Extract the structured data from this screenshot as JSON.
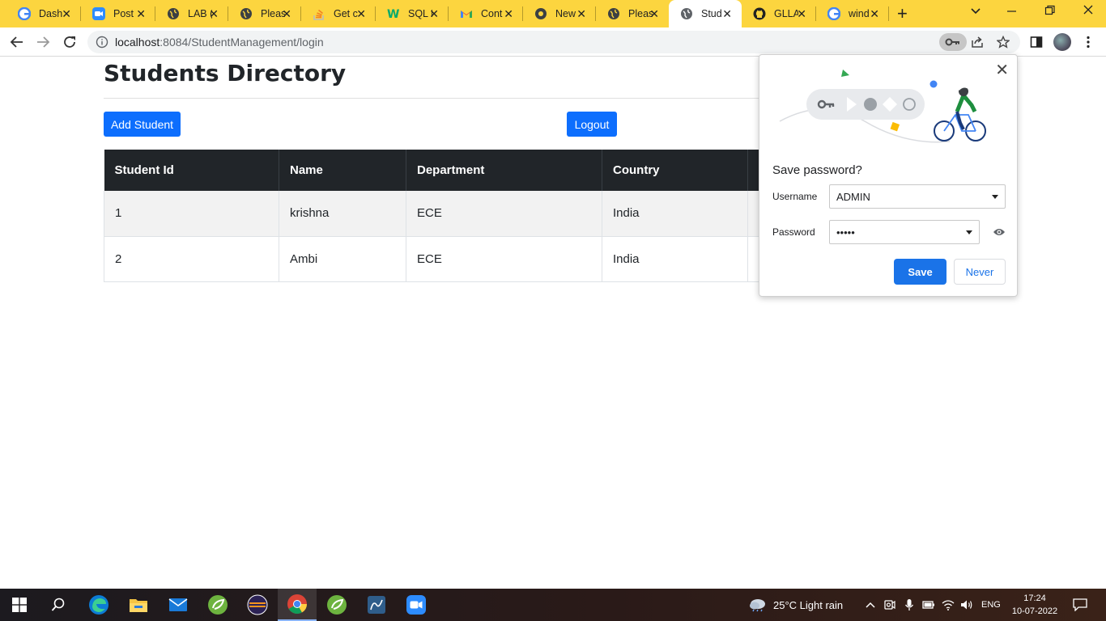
{
  "browser": {
    "tabs": [
      {
        "title": "Dash",
        "icon": "google-g-icon",
        "active": false
      },
      {
        "title": "Post",
        "icon": "zoom-icon",
        "active": false
      },
      {
        "title": "LAB (",
        "icon": "globe-icon",
        "active": false
      },
      {
        "title": "Pleas",
        "icon": "globe-icon",
        "active": false
      },
      {
        "title": "Get c",
        "icon": "stackoverflow-icon",
        "active": false
      },
      {
        "title": "SQL I",
        "icon": "w3schools-icon",
        "active": false
      },
      {
        "title": "Cont",
        "icon": "gmail-icon",
        "active": false
      },
      {
        "title": "New",
        "icon": "chrome-icon",
        "active": false
      },
      {
        "title": "Pleas",
        "icon": "globe-icon",
        "active": false
      },
      {
        "title": "Stud",
        "icon": "globe-icon",
        "active": true
      },
      {
        "title": "GLLA",
        "icon": "github-icon",
        "active": false
      },
      {
        "title": "wind",
        "icon": "google-g-icon",
        "active": false
      }
    ],
    "url_host": "localhost",
    "url_rest": ":8084/StudentManagement/login"
  },
  "page": {
    "title": "Students Directory",
    "add_button": "Add Student",
    "logout_button": "Logout",
    "table": {
      "headers": [
        "Student Id",
        "Name",
        "Department",
        "Country"
      ],
      "rows": [
        [
          "1",
          "krishna",
          "ECE",
          "India"
        ],
        [
          "2",
          "Ambi",
          "ECE",
          "India"
        ]
      ]
    }
  },
  "password_popup": {
    "heading": "Save password?",
    "username_label": "Username",
    "username_value": "ADMIN",
    "password_label": "Password",
    "password_value": "•••••",
    "save_label": "Save",
    "never_label": "Never"
  },
  "taskbar": {
    "weather": "25°C  Light rain",
    "language": "ENG",
    "time": "17:24",
    "date": "10-07-2022"
  },
  "colors": {
    "tab_strip": "#fcd53f",
    "primary_button": "#0d6efd",
    "table_header": "#212529",
    "popup_save": "#1a73e8"
  }
}
